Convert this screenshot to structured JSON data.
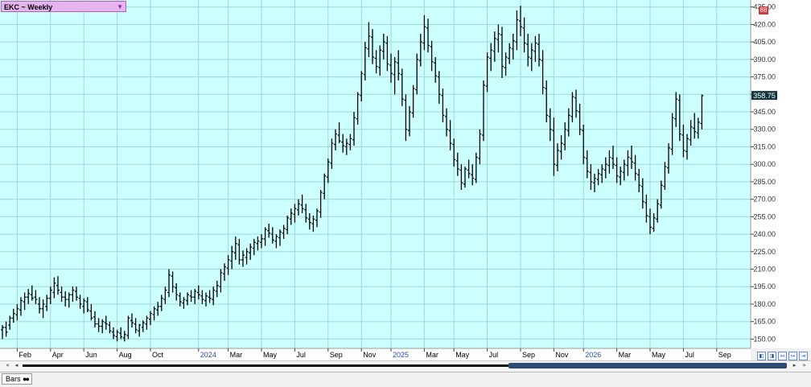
{
  "symbol": {
    "label": "EKC ~ Weekly",
    "dropdown_icon": "triangle-down-icon"
  },
  "corner_badge": "88",
  "last_price": "358.75",
  "colors": {
    "background": "#ccffff",
    "grid": "#9fd7d9",
    "bars": "#000000",
    "last_price_bg": "#0f3640",
    "corner_badge_bg": "#d23b3b",
    "year_label": "#2a4fb0",
    "month_label": "#000000"
  },
  "scrollbar": {
    "left_icon": "◂",
    "right_icon": "▸",
    "page_left": "«",
    "page_right": "»"
  },
  "status_tab": {
    "label": "Bars"
  },
  "axis_nav_buttons": [
    "◧",
    "◨",
    "↤",
    "↦",
    "⇤",
    "⇥"
  ],
  "chart_data": {
    "type": "ohlc",
    "title": "EKC ~ Weekly",
    "y_ticks": [
      "150.00",
      "165.00",
      "180.00",
      "195.00",
      "210.00",
      "225.00",
      "240.00",
      "255.00",
      "270.00",
      "285.00",
      "300.00",
      "315.00",
      "330.00",
      "345.00",
      "360.00",
      "375.00",
      "390.00",
      "405.00",
      "420.00",
      "435.00"
    ],
    "ylim": [
      142,
      441
    ],
    "grid": true,
    "x_labels": [
      {
        "text": "Feb",
        "week": 4,
        "kind": "month"
      },
      {
        "text": "Apr",
        "week": 13,
        "kind": "month"
      },
      {
        "text": "Jun",
        "week": 22,
        "kind": "month"
      },
      {
        "text": "Aug",
        "week": 31,
        "kind": "month"
      },
      {
        "text": "Oct",
        "week": 40,
        "kind": "month"
      },
      {
        "text": "2024",
        "week": 53,
        "kind": "year"
      },
      {
        "text": "Mar",
        "week": 61,
        "kind": "month"
      },
      {
        "text": "May",
        "week": 70,
        "kind": "month"
      },
      {
        "text": "Jul",
        "week": 79,
        "kind": "month"
      },
      {
        "text": "Sep",
        "week": 88,
        "kind": "month"
      },
      {
        "text": "Nov",
        "week": 97,
        "kind": "month"
      },
      {
        "text": "2025",
        "week": 105,
        "kind": "year"
      },
      {
        "text": "Mar",
        "week": 114,
        "kind": "month"
      },
      {
        "text": "May",
        "week": 122,
        "kind": "month"
      },
      {
        "text": "Jul",
        "week": 131,
        "kind": "month"
      },
      {
        "text": "Sep",
        "week": 140,
        "kind": "month"
      },
      {
        "text": "Nov",
        "week": 149,
        "kind": "month"
      },
      {
        "text": "2026",
        "week": 157,
        "kind": "year"
      },
      {
        "text": "Mar",
        "week": 166,
        "kind": "month"
      },
      {
        "text": "May",
        "week": 175,
        "kind": "month"
      },
      {
        "text": "Jul",
        "week": 184,
        "kind": "month"
      },
      {
        "text": "Sep",
        "week": 193,
        "kind": "month"
      }
    ],
    "bars": [
      [
        158,
        162,
        150,
        160
      ],
      [
        160,
        165,
        152,
        156
      ],
      [
        162,
        170,
        158,
        168
      ],
      [
        168,
        176,
        164,
        172
      ],
      [
        171,
        180,
        166,
        176
      ],
      [
        175,
        186,
        170,
        183
      ],
      [
        182,
        190,
        175,
        186
      ],
      [
        186,
        193,
        180,
        189
      ],
      [
        188,
        196,
        183,
        185
      ],
      [
        186,
        192,
        180,
        184
      ],
      [
        180,
        186,
        172,
        176
      ],
      [
        176,
        184,
        168,
        180
      ],
      [
        178,
        188,
        174,
        185
      ],
      [
        185,
        195,
        180,
        192
      ],
      [
        190,
        203,
        185,
        198
      ],
      [
        196,
        204,
        188,
        192
      ],
      [
        190,
        195,
        182,
        186
      ],
      [
        186,
        191,
        178,
        184
      ],
      [
        184,
        190,
        177,
        188
      ],
      [
        188,
        195,
        182,
        192
      ],
      [
        191,
        195,
        183,
        186
      ],
      [
        185,
        188,
        176,
        180
      ],
      [
        178,
        185,
        172,
        183
      ],
      [
        182,
        186,
        173,
        175
      ],
      [
        174,
        180,
        166,
        168
      ],
      [
        169,
        174,
        160,
        163
      ],
      [
        163,
        168,
        156,
        161
      ],
      [
        161,
        167,
        155,
        165
      ],
      [
        164,
        170,
        158,
        163
      ],
      [
        162,
        165,
        155,
        157
      ],
      [
        156,
        160,
        150,
        153
      ],
      [
        152,
        158,
        148,
        156
      ],
      [
        155,
        160,
        150,
        152
      ],
      [
        151,
        157,
        148,
        154
      ],
      [
        153,
        170,
        150,
        168
      ],
      [
        166,
        172,
        160,
        164
      ],
      [
        163,
        168,
        155,
        158
      ],
      [
        157,
        163,
        152,
        162
      ],
      [
        160,
        166,
        156,
        164
      ],
      [
        163,
        170,
        158,
        168
      ],
      [
        167,
        174,
        162,
        172
      ],
      [
        171,
        178,
        166,
        176
      ],
      [
        175,
        182,
        170,
        178
      ],
      [
        178,
        188,
        174,
        185
      ],
      [
        184,
        195,
        180,
        192
      ],
      [
        190,
        210,
        186,
        205
      ],
      [
        204,
        208,
        190,
        195
      ],
      [
        194,
        198,
        183,
        188
      ],
      [
        187,
        190,
        178,
        182
      ],
      [
        181,
        186,
        176,
        184
      ],
      [
        183,
        190,
        179,
        188
      ],
      [
        187,
        192,
        182,
        186
      ],
      [
        186,
        193,
        180,
        191
      ],
      [
        190,
        196,
        184,
        188
      ],
      [
        187,
        192,
        180,
        184
      ],
      [
        183,
        190,
        178,
        187
      ],
      [
        186,
        192,
        181,
        185
      ],
      [
        184,
        195,
        179,
        192
      ],
      [
        191,
        200,
        186,
        196
      ],
      [
        195,
        210,
        190,
        207
      ],
      [
        206,
        215,
        200,
        212
      ],
      [
        211,
        222,
        205,
        218
      ],
      [
        217,
        230,
        210,
        225
      ],
      [
        224,
        238,
        218,
        232
      ],
      [
        231,
        236,
        214,
        218
      ],
      [
        218,
        226,
        212,
        222
      ],
      [
        220,
        228,
        214,
        225
      ],
      [
        224,
        232,
        218,
        229
      ],
      [
        228,
        236,
        222,
        233
      ],
      [
        232,
        238,
        226,
        234
      ],
      [
        233,
        240,
        228,
        236
      ],
      [
        236,
        246,
        230,
        244
      ],
      [
        243,
        249,
        237,
        241
      ],
      [
        240,
        246,
        232,
        235
      ],
      [
        234,
        240,
        228,
        238
      ],
      [
        237,
        244,
        230,
        242
      ],
      [
        241,
        248,
        236,
        245
      ],
      [
        244,
        256,
        240,
        254
      ],
      [
        253,
        262,
        248,
        258
      ],
      [
        257,
        266,
        250,
        262
      ],
      [
        261,
        270,
        256,
        266
      ],
      [
        265,
        274,
        258,
        262
      ],
      [
        261,
        266,
        250,
        254
      ],
      [
        253,
        258,
        244,
        250
      ],
      [
        249,
        256,
        242,
        253
      ],
      [
        252,
        262,
        246,
        260
      ],
      [
        259,
        278,
        254,
        276
      ],
      [
        275,
        292,
        270,
        290
      ],
      [
        289,
        305,
        284,
        302
      ],
      [
        301,
        322,
        296,
        318
      ],
      [
        317,
        330,
        312,
        326
      ],
      [
        325,
        336,
        318,
        320
      ],
      [
        319,
        326,
        310,
        316
      ],
      [
        315,
        322,
        308,
        318
      ],
      [
        317,
        326,
        312,
        322
      ],
      [
        321,
        345,
        316,
        340
      ],
      [
        339,
        362,
        334,
        360
      ],
      [
        359,
        380,
        354,
        378
      ],
      [
        377,
        405,
        372,
        400
      ],
      [
        399,
        422,
        392,
        410
      ],
      [
        409,
        416,
        386,
        392
      ],
      [
        391,
        398,
        378,
        384
      ],
      [
        383,
        402,
        376,
        398
      ],
      [
        397,
        412,
        390,
        405
      ],
      [
        404,
        410,
        380,
        386
      ],
      [
        385,
        395,
        370,
        378
      ],
      [
        377,
        392,
        360,
        388
      ],
      [
        387,
        398,
        372,
        378
      ],
      [
        377,
        382,
        350,
        356
      ],
      [
        355,
        360,
        320,
        330
      ],
      [
        329,
        350,
        324,
        345
      ],
      [
        344,
        368,
        340,
        365
      ],
      [
        364,
        395,
        360,
        390
      ],
      [
        389,
        412,
        384,
        405
      ],
      [
        404,
        428,
        398,
        418
      ],
      [
        417,
        425,
        396,
        402
      ],
      [
        401,
        406,
        380,
        388
      ],
      [
        387,
        392,
        370,
        376
      ],
      [
        375,
        380,
        352,
        360
      ],
      [
        359,
        365,
        336,
        342
      ],
      [
        341,
        348,
        324,
        330
      ],
      [
        329,
        338,
        312,
        318
      ],
      [
        317,
        322,
        298,
        304
      ],
      [
        303,
        310,
        290,
        296
      ],
      [
        295,
        300,
        278,
        284
      ],
      [
        283,
        298,
        280,
        296
      ],
      [
        295,
        304,
        288,
        292
      ],
      [
        291,
        300,
        282,
        288
      ],
      [
        287,
        310,
        284,
        306
      ],
      [
        305,
        330,
        300,
        326
      ],
      [
        325,
        372,
        320,
        368
      ],
      [
        367,
        396,
        362,
        392
      ],
      [
        391,
        404,
        380,
        398
      ],
      [
        397,
        414,
        388,
        408
      ],
      [
        407,
        420,
        396,
        412
      ],
      [
        411,
        418,
        374,
        384
      ],
      [
        383,
        396,
        376,
        392
      ],
      [
        391,
        404,
        386,
        400
      ],
      [
        399,
        412,
        390,
        406
      ],
      [
        405,
        432,
        398,
        424
      ],
      [
        423,
        436,
        410,
        418
      ],
      [
        417,
        426,
        396,
        404
      ],
      [
        403,
        412,
        384,
        392
      ],
      [
        391,
        404,
        380,
        398
      ],
      [
        397,
        410,
        388,
        404
      ],
      [
        403,
        412,
        384,
        390
      ],
      [
        389,
        398,
        360,
        366
      ],
      [
        365,
        372,
        336,
        342
      ],
      [
        341,
        348,
        320,
        330
      ],
      [
        329,
        340,
        290,
        300
      ],
      [
        299,
        318,
        294,
        312
      ],
      [
        311,
        325,
        304,
        318
      ],
      [
        317,
        336,
        312,
        330
      ],
      [
        329,
        348,
        324,
        342
      ],
      [
        341,
        362,
        336,
        358
      ],
      [
        357,
        364,
        340,
        346
      ],
      [
        345,
        352,
        325,
        330
      ],
      [
        329,
        334,
        300,
        306
      ],
      [
        305,
        312,
        288,
        294
      ],
      [
        293,
        300,
        278,
        285
      ],
      [
        284,
        292,
        276,
        288
      ],
      [
        287,
        296,
        282,
        292
      ],
      [
        291,
        300,
        284,
        296
      ],
      [
        295,
        306,
        288,
        300
      ],
      [
        299,
        312,
        292,
        306
      ],
      [
        305,
        316,
        296,
        300
      ],
      [
        299,
        306,
        284,
        290
      ],
      [
        289,
        298,
        282,
        294
      ],
      [
        293,
        304,
        286,
        300
      ],
      [
        299,
        312,
        290,
        306
      ],
      [
        305,
        316,
        296,
        302
      ],
      [
        301,
        308,
        286,
        292
      ],
      [
        291,
        296,
        276,
        282
      ],
      [
        281,
        288,
        262,
        268
      ],
      [
        267,
        274,
        250,
        256
      ],
      [
        255,
        262,
        240,
        246
      ],
      [
        245,
        258,
        242,
        254
      ],
      [
        253,
        270,
        250,
        266
      ],
      [
        265,
        286,
        262,
        282
      ],
      [
        281,
        302,
        278,
        298
      ],
      [
        297,
        318,
        292,
        314
      ],
      [
        313,
        344,
        308,
        340
      ],
      [
        339,
        362,
        332,
        356
      ],
      [
        355,
        360,
        320,
        326
      ],
      [
        325,
        334,
        306,
        312
      ],
      [
        311,
        326,
        304,
        322
      ],
      [
        321,
        338,
        316,
        332
      ],
      [
        331,
        344,
        322,
        328
      ],
      [
        327,
        340,
        322,
        336
      ],
      [
        335,
        360,
        330,
        358.75
      ]
    ]
  }
}
